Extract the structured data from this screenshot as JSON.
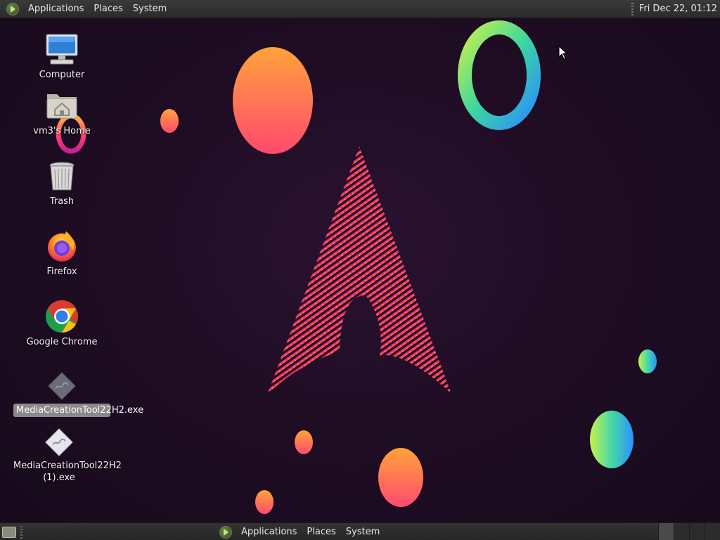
{
  "top_panel": {
    "menu": {
      "applications": "Applications",
      "places": "Places",
      "system": "System"
    },
    "clock": "Fri Dec 22, 01:12"
  },
  "desktop": {
    "icons": [
      {
        "label": "Computer",
        "icon": "computer-icon"
      },
      {
        "label": "vm3's Home",
        "icon": "home-folder-icon"
      },
      {
        "label": "Trash",
        "icon": "trash-icon"
      },
      {
        "label": "Firefox",
        "icon": "firefox-icon"
      },
      {
        "label": "Google Chrome",
        "icon": "chrome-icon"
      },
      {
        "label": "MediaCreationTool22H2.exe",
        "icon": "exe-icon",
        "selected": true
      },
      {
        "label": "MediaCreationTool22H2 (1).exe",
        "icon": "exe-icon"
      }
    ]
  },
  "bottom_panel": {
    "menu": {
      "applications": "Applications",
      "places": "Places",
      "system": "System"
    },
    "workspaces": 4
  },
  "colors": {
    "panel": "#2b2b2b",
    "desktop_bg": "#1f0d24",
    "selection": "#8a8a8a"
  }
}
